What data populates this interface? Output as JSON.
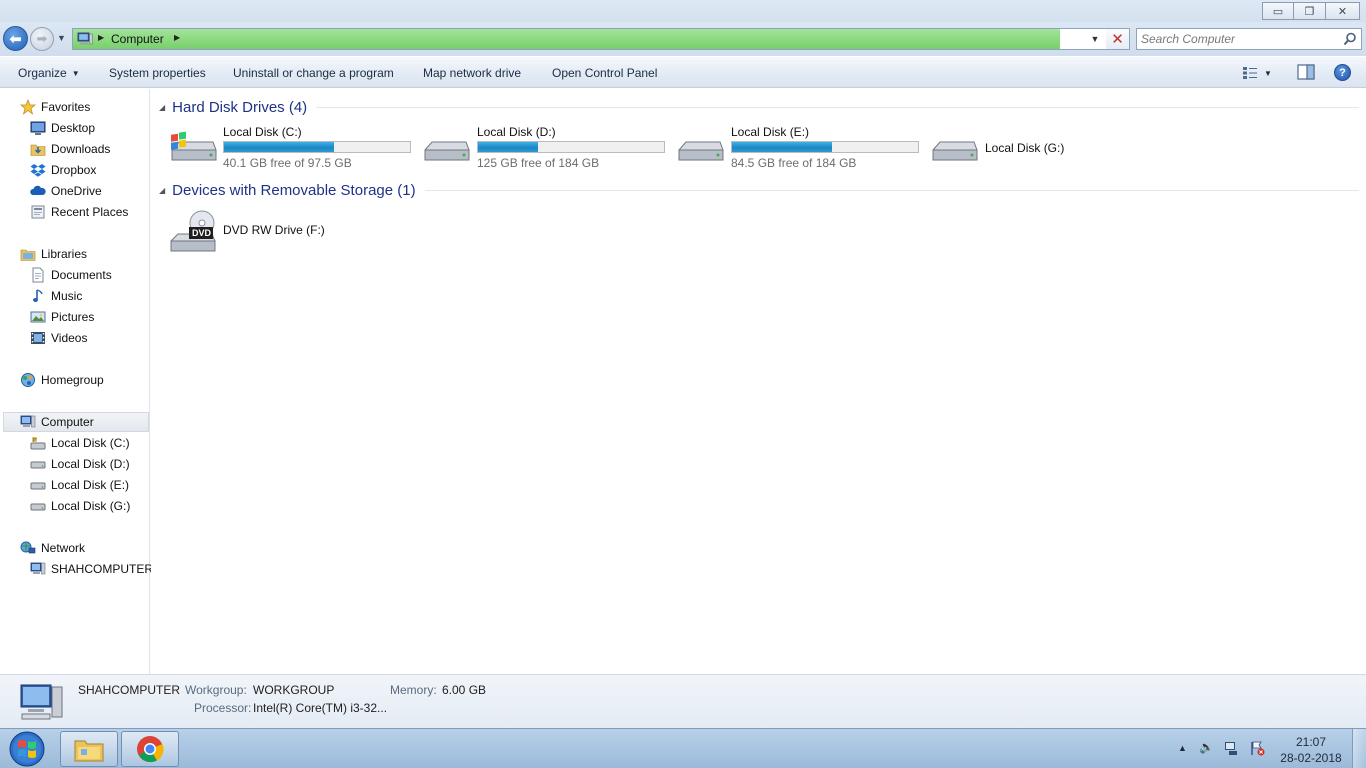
{
  "window": {
    "minimize_glyph": "▭",
    "maximize_glyph": "❐",
    "close_glyph": "✕"
  },
  "address": {
    "location": "Computer",
    "search_placeholder": "Search Computer"
  },
  "toolbar": {
    "organize": "Organize",
    "system_properties": "System properties",
    "uninstall": "Uninstall or change a program",
    "map_network": "Map network drive",
    "control_panel": "Open Control Panel"
  },
  "nav": {
    "favorites": "Favorites",
    "desktop": "Desktop",
    "downloads": "Downloads",
    "dropbox": "Dropbox",
    "onedrive": "OneDrive",
    "recent_places": "Recent Places",
    "libraries": "Libraries",
    "documents": "Documents",
    "music": "Music",
    "pictures": "Pictures",
    "videos": "Videos",
    "homegroup": "Homegroup",
    "computer": "Computer",
    "disk_c": "Local Disk (C:)",
    "disk_d": "Local Disk (D:)",
    "disk_e": "Local Disk (E:)",
    "disk_g": "Local Disk (G:)",
    "network": "Network",
    "shahcomputer": "SHAHCOMPUTER"
  },
  "content": {
    "hdd_group": "Hard Disk Drives (4)",
    "removable_group": "Devices with Removable Storage (1)",
    "drives": [
      {
        "name": "Local Disk (C:)",
        "free_text": "40.1 GB free of 97.5 GB",
        "used_fraction": 0.59
      },
      {
        "name": "Local Disk (D:)",
        "free_text": "125 GB free of 184 GB",
        "used_fraction": 0.32
      },
      {
        "name": "Local Disk (E:)",
        "free_text": "84.5 GB free of 184 GB",
        "used_fraction": 0.54
      },
      {
        "name": "Local Disk (G:)"
      }
    ],
    "dvd": {
      "name": "DVD RW Drive (F:)",
      "badge": "DVD"
    }
  },
  "details": {
    "computer_name": "SHAHCOMPUTER",
    "workgroup_label": "Workgroup:",
    "workgroup_value": "WORKGROUP",
    "memory_label": "Memory:",
    "memory_value": "6.00 GB",
    "processor_label": "Processor:",
    "processor_value": "Intel(R) Core(TM) i3-32..."
  },
  "taskbar": {
    "time": "21:07",
    "date": "28-02-2018"
  },
  "colors": {
    "accent_blue": "#1e3287",
    "progress_green": "#78d06b",
    "drive_bar": "#1e86c4"
  }
}
